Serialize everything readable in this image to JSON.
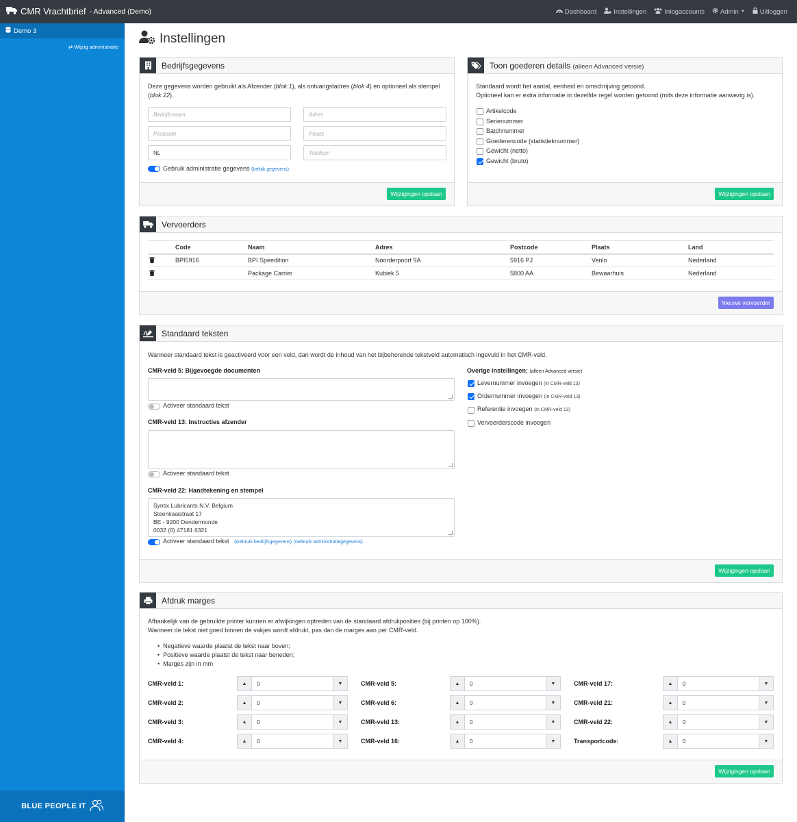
{
  "topbar": {
    "app_title": "CMR Vrachtbrief",
    "app_subtitle": "- Advanced (Demo)",
    "nav": [
      {
        "label": "Dashboard",
        "icon": "dashboard-icon"
      },
      {
        "label": "Instellingen",
        "icon": "users-cog-icon"
      },
      {
        "label": "Inlogaccounts",
        "icon": "users-icon"
      },
      {
        "label": "Admin",
        "icon": "gear-icon"
      },
      {
        "label": "Uitloggen",
        "icon": "lock-icon"
      }
    ]
  },
  "sidebar": {
    "active_item": "Demo 3",
    "switch_link": "Wijzig administratie",
    "footer_brand": "BLUE PEOPLE IT"
  },
  "page": {
    "title": "Instellingen"
  },
  "company": {
    "title": "Bedrijfsgegevens",
    "intro_1": "Deze gegevens worden gebruikt als Afzender (",
    "intro_blok1": "blok 1",
    "intro_2": "), als ontvangstadres (",
    "intro_blok4": "blok 4",
    "intro_3": ") en optioneel als stempel",
    "intro_4": "(",
    "intro_blok22": "blok 22",
    "intro_5": ").",
    "fields": {
      "company_name": {
        "placeholder": "Bedrijfsnaam",
        "value": ""
      },
      "address": {
        "placeholder": "Adres",
        "value": ""
      },
      "postcode": {
        "placeholder": "Postcode",
        "value": ""
      },
      "city": {
        "placeholder": "Plaats",
        "value": ""
      },
      "country": {
        "placeholder": "",
        "value": "NL"
      },
      "phone": {
        "placeholder": "Telefoon",
        "value": ""
      }
    },
    "toggle_label": "Gebruik administratie gegevens",
    "toggle_link": "(bekijk gegevens)",
    "save": "Wijzigingen opslaan"
  },
  "goods": {
    "title": "Toon goederen details",
    "title_note": "(alleen Advanced versie)",
    "intro_1": "Standaard wordt het aantal, eenheid en omschrijving getoond.",
    "intro_2": "Optioneel kan er extra informatie in dezelfde regel worden getoond (mits deze informatie aanwezig is).",
    "options": [
      {
        "label": "Artikelcode",
        "checked": false
      },
      {
        "label": "Serienummer",
        "checked": false
      },
      {
        "label": "Batchnummer",
        "checked": false
      },
      {
        "label": "Goederencode (statistieknummer)",
        "checked": false
      },
      {
        "label": "Gewicht (netto)",
        "checked": false
      },
      {
        "label": "Gewicht (bruto)",
        "checked": true
      }
    ],
    "save": "Wijzigingen opslaan"
  },
  "carriers": {
    "title": "Vervoerders",
    "columns": [
      "Code",
      "Naam",
      "Adres",
      "Postcode",
      "Plaats",
      "Land"
    ],
    "rows": [
      [
        "BPI5916",
        "BPI Speedition",
        "Noorderpoort 9A",
        "5916 PJ",
        "Venlo",
        "Nederland"
      ],
      [
        "",
        "Package Carrier",
        "Kubiek 5",
        "5800 AA",
        "Bewaarhuis",
        "Nederland"
      ]
    ],
    "new_button": "Nieuwe vervoerder"
  },
  "texts": {
    "title": "Standaard teksten",
    "intro": "Wanneer standaard tekst is geactiveerd voor een veld, dan wordt de inhoud van het bijbehorende tekstveld automatisch ingevuld in het CMR-veld.",
    "field5_label": "CMR-veld 5: Bijgevoegde documenten",
    "field13_label": "CMR-veld 13: Instructies afzender",
    "field22_label": "CMR-veld 22: Handtekening en stempel",
    "field22_lines": [
      "Syntix Lubricants N.V. Belgium",
      "Steenkaaistraat 17",
      "BE - 9200 Dendermonde",
      "0032 (0) 47181 6321"
    ],
    "activate_label": "Activeer standaard tekst",
    "use_company_link": "(Gebruik bedrijfsgegevens)",
    "use_admin_link": "(Gebruik administratiegegevens)",
    "other_title": "Overige instellingen:",
    "other_note": "(alleen Advanced versie)",
    "other_options": [
      {
        "label": "Levernummer invoegen",
        "hint": "(in CMR-veld 13)",
        "checked": true
      },
      {
        "label": "Ordernummer invoegen",
        "hint": "(in CMR-veld 13)",
        "checked": true
      },
      {
        "label": "Referentie invoegen",
        "hint": "(in CMR-veld 13)",
        "checked": false
      },
      {
        "label": "Vervoerderscode invoegen",
        "hint": "",
        "checked": false
      }
    ],
    "save": "Wijzigingen opslaan"
  },
  "margins": {
    "title": "Afdruk marges",
    "intro_1": "Afhankelijk van de gebruikte printer kunnen er afwijkingen optreden van de standaard afdrukposities (bij printen op 100%).",
    "intro_2": "Wanneer de tekst niet goed binnen de vakjes wordt afdrukt, pas dan de marges aan per CMR-veld.",
    "bullets": [
      "Negatieve waarde plaatst de tekst naar boven;",
      "Positieve waarde plaatst de tekst naar beneden;",
      "Marges zijn in mm"
    ],
    "fields": [
      {
        "label": "CMR-veld 1:",
        "value": "0"
      },
      {
        "label": "CMR-veld 5:",
        "value": "0"
      },
      {
        "label": "CMR-veld 17:",
        "value": "0"
      },
      {
        "label": "CMR-veld 2:",
        "value": "0"
      },
      {
        "label": "CMR-veld 6:",
        "value": "0"
      },
      {
        "label": "CMR-veld 21:",
        "value": "0"
      },
      {
        "label": "CMR-veld 3:",
        "value": "0"
      },
      {
        "label": "CMR-veld 13:",
        "value": "0"
      },
      {
        "label": "CMR-veld 22:",
        "value": "0"
      },
      {
        "label": "CMR-veld 4:",
        "value": "0"
      },
      {
        "label": "CMR-veld 16:",
        "value": "0"
      },
      {
        "label": "Transportcode:",
        "value": "0"
      }
    ],
    "save": "Wijzigingen opslaan"
  },
  "colors": {
    "topbar": "#353a40",
    "sidebar": "#0d86d8",
    "accent_green": "#1cc88a",
    "accent_purple": "#7b7bee",
    "link_blue": "#1e7ad6"
  }
}
